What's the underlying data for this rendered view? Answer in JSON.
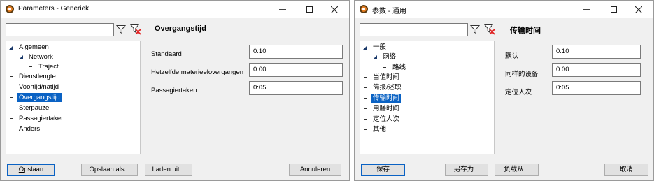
{
  "left": {
    "title": "Parameters - Generiek",
    "section_title": "Overgangstijd",
    "tree": [
      "Algemeen",
      "Network",
      "Traject",
      "Dienstlengte",
      "Voortijd/natijd",
      "Overgangstijd",
      "Sterpauze",
      "Passagiertaken",
      "Anders"
    ],
    "fields": [
      {
        "label": "Standaard",
        "value": "0:10"
      },
      {
        "label": "Hetzelfde materieelovergangen",
        "value": "0:00"
      },
      {
        "label": "Passagiertaken",
        "value": "0:05"
      }
    ],
    "buttons": {
      "save_first": "O",
      "save_rest": "pslaan",
      "save_as": "Opslaan als...",
      "load": "Laden uit...",
      "cancel": "Annuleren"
    }
  },
  "right": {
    "title": "参数 - 通用",
    "section_title": "传输时间",
    "tree": [
      "一般",
      "网络",
      "路线",
      "当值时间",
      "简报/述职",
      "传输时间",
      "用膳时间",
      "定位人次",
      "其他"
    ],
    "fields": [
      {
        "label": "默认",
        "value": "0:10"
      },
      {
        "label": "同样的设备",
        "value": "0:00"
      },
      {
        "label": "定位人次",
        "value": "0:05"
      }
    ],
    "buttons": {
      "save": "保存",
      "save_as": "另存为...",
      "load": "负载从...",
      "cancel": "取消"
    }
  },
  "icons": {
    "app": "app-logo-icon",
    "filter": "filter-icon",
    "clear_filter": "clear-filter-icon",
    "minimize": "minimize-icon",
    "maximize": "maximize-icon",
    "close": "close-icon",
    "expanded": "expanded-triangle-icon",
    "leaf": "leaf-dash-icon"
  },
  "colors": {
    "selection": "#0a62c4",
    "tree_marker": "#1b3a6b",
    "app_icon": "#e67e22"
  }
}
